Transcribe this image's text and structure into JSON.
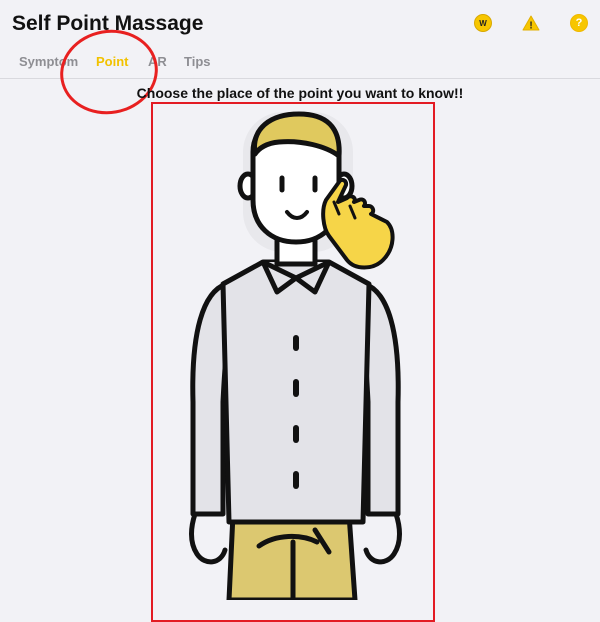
{
  "header": {
    "title": "Self Point Massage",
    "icons": [
      {
        "name": "w-badge-icon",
        "glyph": "W"
      },
      {
        "name": "warning-icon",
        "glyph": "!"
      },
      {
        "name": "help-icon",
        "glyph": "?"
      }
    ]
  },
  "tabs": [
    {
      "label": "Symptom",
      "active": false
    },
    {
      "label": "Point",
      "active": true
    },
    {
      "label": "AR",
      "active": false
    },
    {
      "label": "Tips",
      "active": false
    }
  ],
  "main": {
    "instruction": "Choose the place of the point you want to know!!"
  },
  "colors": {
    "accent": "#f2c200",
    "annotation_red": "#e31b23",
    "shirt": "#e3e3e8",
    "pants": "#dcc870",
    "hand": "#f6d548",
    "hair": "#e0c95e"
  }
}
